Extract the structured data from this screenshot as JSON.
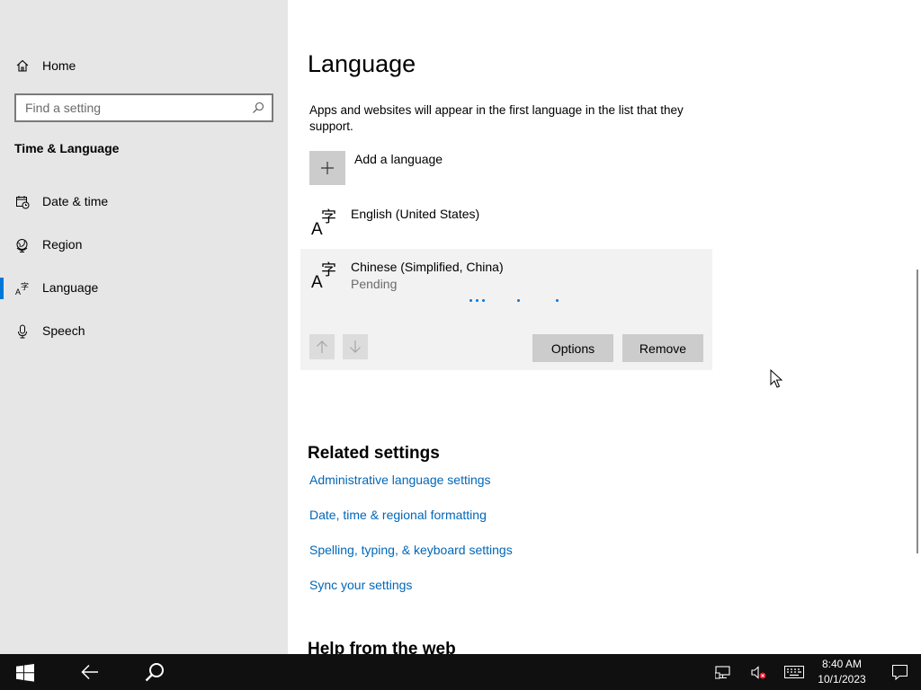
{
  "sidebar": {
    "home_label": "Home",
    "search_placeholder": "Find a setting",
    "section_title": "Time & Language",
    "items": [
      {
        "label": "Date & time",
        "icon": "calendar-clock-icon"
      },
      {
        "label": "Region",
        "icon": "globe-icon"
      },
      {
        "label": "Language",
        "icon": "language-icon",
        "active": true
      },
      {
        "label": "Speech",
        "icon": "microphone-icon"
      }
    ]
  },
  "main": {
    "title": "Language",
    "description": "Apps and websites will appear in the first language in the list that they support.",
    "add_language_label": "Add a language",
    "languages": [
      {
        "name": "English (United States)",
        "status": ""
      },
      {
        "name": "Chinese (Simplified, China)",
        "status": "Pending",
        "selected": true
      }
    ],
    "options_label": "Options",
    "remove_label": "Remove",
    "related_title": "Related settings",
    "related_links": [
      "Administrative language settings",
      "Date, time & regional formatting",
      "Spelling, typing, & keyboard settings",
      "Sync your settings"
    ],
    "help_title": "Help from the web"
  },
  "taskbar": {
    "time": "8:40 AM",
    "date": "10/1/2023",
    "icons": [
      "start-icon",
      "back-icon",
      "search-icon",
      "network-icon",
      "volume-muted-icon",
      "keyboard-icon",
      "notification-icon"
    ]
  },
  "colors": {
    "accent": "#0078d7",
    "link": "#0067b8",
    "sidebar_bg": "#e6e6e6",
    "taskbar_bg": "#101010"
  }
}
